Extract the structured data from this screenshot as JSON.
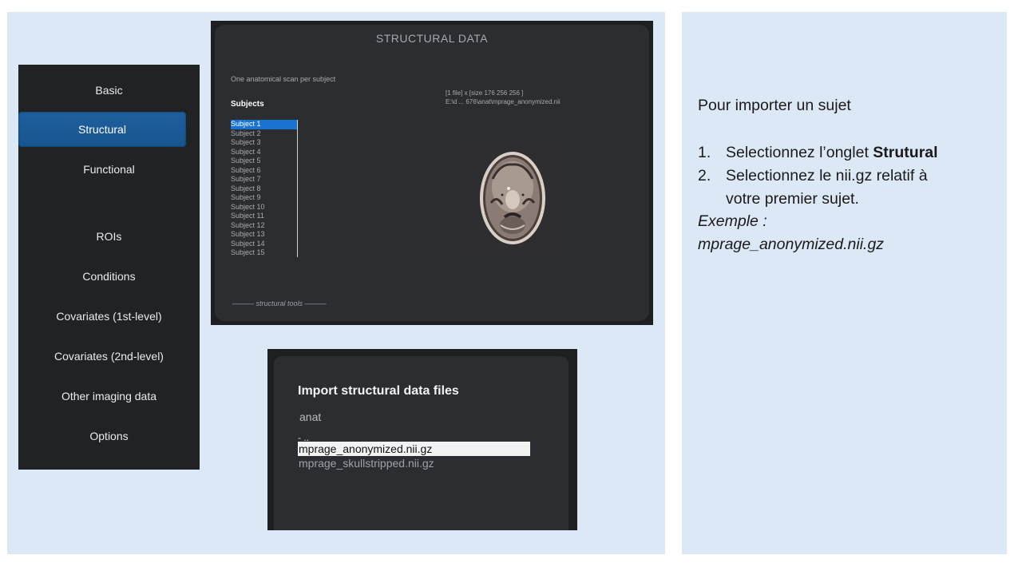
{
  "sidebar": {
    "items": [
      {
        "label": "Basic",
        "active": false
      },
      {
        "label": "Structural",
        "active": true
      },
      {
        "label": "Functional",
        "active": false
      },
      {
        "label": "ROIs",
        "active": false
      },
      {
        "label": "Conditions",
        "active": false
      },
      {
        "label": "Covariates (1st-level)",
        "active": false
      },
      {
        "label": "Covariates (2nd-level)",
        "active": false
      },
      {
        "label": "Other imaging data",
        "active": false
      },
      {
        "label": "Options",
        "active": false
      }
    ]
  },
  "structural": {
    "title": "STRUCTURAL DATA",
    "description": "One anatomical scan per subject",
    "subjects_label": "Subjects",
    "subjects": [
      "Subject  1",
      "Subject  2",
      "Subject  3",
      "Subject  4",
      "Subject  5",
      "Subject  6",
      "Subject  7",
      "Subject  8",
      "Subject  9",
      "Subject 10",
      "Subject 11",
      "Subject 12",
      "Subject 13",
      "Subject 14",
      "Subject 15"
    ],
    "selected_subject": "Subject  1",
    "file_info": "[1 file] x [size 176 256 256 ]",
    "file_path": "E:\\d ... 676\\anat\\mprage_anonymized.nii",
    "tools_dash_left": "———",
    "tools_label": "structural tools",
    "tools_dash_right": "———"
  },
  "import_dialog": {
    "title": "Import structural data files",
    "folder": "anat",
    "parent_entry": "- ..",
    "files": [
      {
        "name": "mprage_anonymized.nii.gz",
        "selected": true
      },
      {
        "name": "mprage_skullstripped.nii.gz",
        "selected": false
      }
    ]
  },
  "instructions": {
    "heading": "Pour importer un sujet",
    "step1_num": "1.",
    "step1_text": "Selectionnez l’onglet ",
    "step1_bold": "Strutural",
    "step2_num": "2.",
    "step2_line1": "Selectionnez le nii.gz relatif à",
    "step2_line2": "votre premier sujet.",
    "example_label": "Exemple :",
    "example_value": "mprage_anonymized.nii.gz"
  },
  "colors": {
    "sidebar_bg": "#202224",
    "active_tab": "#1f5f9e",
    "window_bg": "#2b2d30",
    "slide_panel": "#dce8f5"
  }
}
